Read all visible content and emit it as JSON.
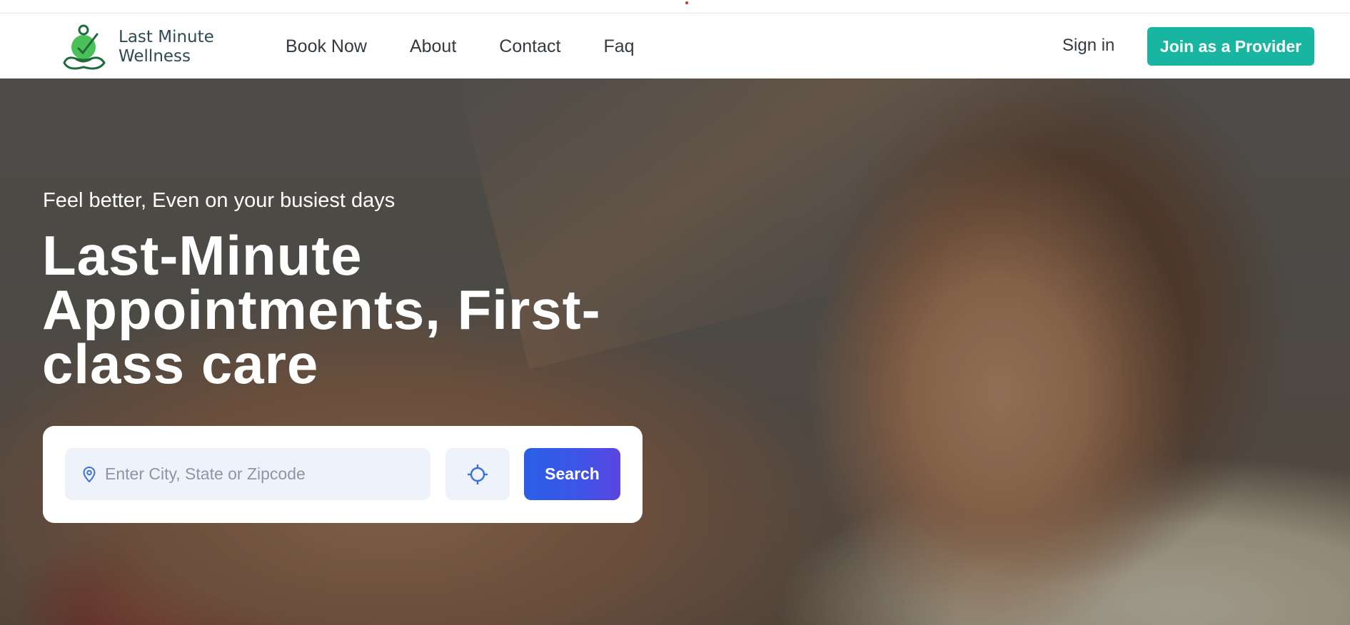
{
  "brand": {
    "name_line1": "Last Minute",
    "name_line2": "Wellness",
    "logo_icon": "meditating-figure-clock-icon",
    "logo_color": "#3cb54a"
  },
  "nav": {
    "items": [
      {
        "label": "Book Now"
      },
      {
        "label": "About"
      },
      {
        "label": "Contact"
      },
      {
        "label": "Faq"
      }
    ]
  },
  "header": {
    "signin_label": "Sign in",
    "join_label": "Join as a Provider",
    "join_color": "#18b5a0"
  },
  "hero": {
    "tagline": "Feel better, Even on your busiest days",
    "headline_line1": "Last-Minute",
    "headline_line2": "Appointments, First-",
    "headline_line3": "class care",
    "background_image": "woman receiving back massage"
  },
  "search": {
    "placeholder": "Enter City, State or Zipcode",
    "value": "",
    "location_icon": "map-pin-icon",
    "gps_icon": "crosshair-icon",
    "button_label": "Search",
    "button_color_start": "#2a5fe6",
    "button_color_end": "#5a45e0"
  }
}
